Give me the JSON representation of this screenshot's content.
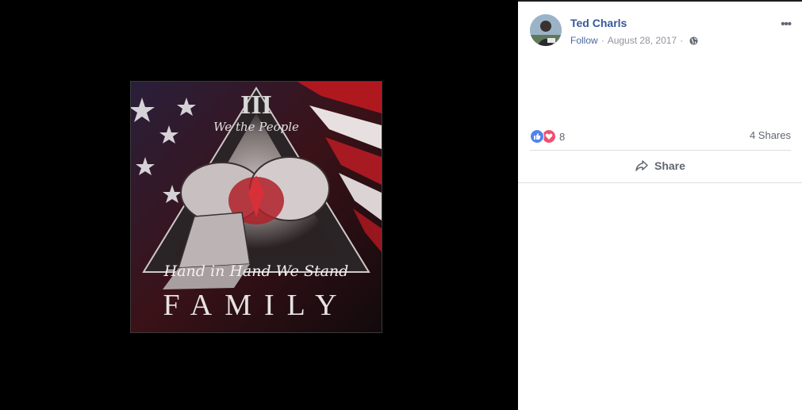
{
  "post": {
    "author": "Ted Charls",
    "follow_label": "Follow",
    "separator": "·",
    "date": "August 28, 2017",
    "more_label": "•••",
    "privacy_icon": "globe-icon"
  },
  "photo": {
    "numeral": "III",
    "top_script": "We the People",
    "motto": "Hand in Hand We Stand",
    "word": "FAMILY"
  },
  "engagement": {
    "reaction_icons": [
      "like-icon",
      "love-icon"
    ],
    "reaction_count": "8",
    "shares_label": "4 Shares",
    "share_button_label": "Share"
  },
  "colors": {
    "link": "#365899",
    "muted": "#90949c",
    "like": "#4f83ef",
    "love": "#f0506e"
  }
}
